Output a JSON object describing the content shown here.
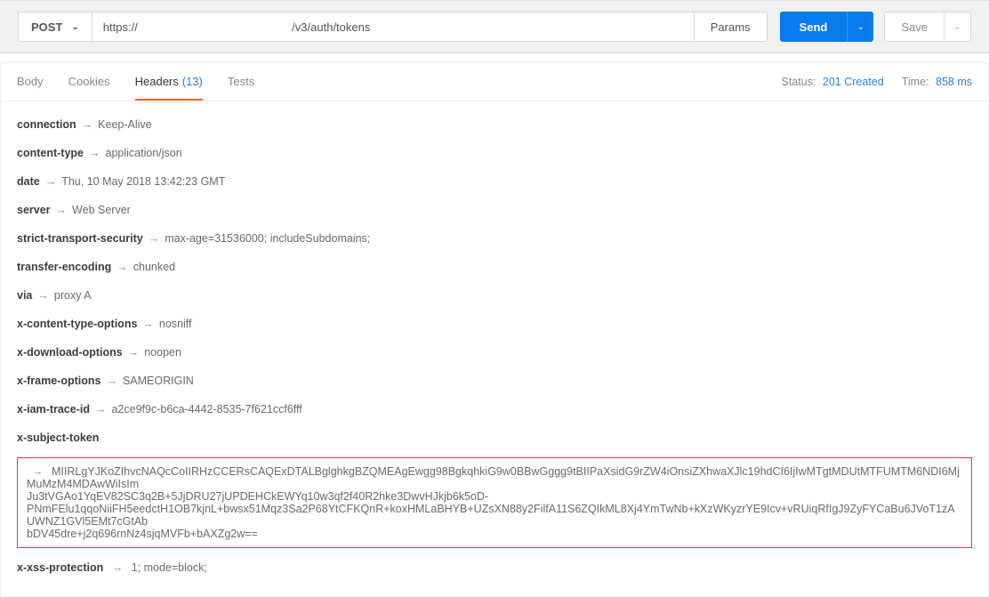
{
  "toolbar": {
    "method": "POST",
    "url_prefix": "https://",
    "url_blur": "                                                ",
    "url_suffix": "/v3/auth/tokens",
    "params": "Params",
    "send": "Send",
    "save": "Save"
  },
  "tabs": {
    "body": "Body",
    "cookies": "Cookies",
    "headers": "Headers",
    "headers_count": "(13)",
    "tests": "Tests"
  },
  "meta": {
    "status_label": "Status:",
    "status_value": "201 Created",
    "time_label": "Time:",
    "time_value": "858 ms"
  },
  "headers": [
    {
      "key": "connection",
      "value": "Keep-Alive"
    },
    {
      "key": "content-type",
      "value": "application/json"
    },
    {
      "key": "date",
      "value": "Thu, 10 May 2018 13:42:23 GMT"
    },
    {
      "key": "server",
      "value": "Web Server"
    },
    {
      "key": "strict-transport-security",
      "value": "max-age=31536000; includeSubdomains;"
    },
    {
      "key": "transfer-encoding",
      "value": "chunked"
    },
    {
      "key": "via",
      "value": "proxy A"
    },
    {
      "key": "x-content-type-options",
      "value": "nosniff"
    },
    {
      "key": "x-download-options",
      "value": "noopen"
    },
    {
      "key": "x-frame-options",
      "value": "SAMEORIGIN"
    },
    {
      "key": "x-iam-trace-id",
      "value": "a2ce9f9c-b6ca-4442-8535-7f621ccf6fff"
    }
  ],
  "token": {
    "key": "x-subject-token",
    "value": "MIIRLgYJKoZIhvcNAQcCoIIRHzCCERsCAQExDTALBglghkgBZQMEAgEwgg98BgkqhkiG9w0BBwGggg9tBIIPaXsidG9rZW4iOnsiZXhwaXJlc19hdCI6IjIwMTgtMDUtMTFUMTM6NDI6MjMuMzM4MDAwWiIsIm\nJu3tVGAo1YqEV82SC3q2B+5JjDRU27jUPDEHCkEWYq10w3qf2f40R2hke3DwvHJkjb6k5oD-\nPNmFElu1qqoNiiFH5eedctH1OB7kjnL+bwsx51Mqz3Sa2P68YtCFKQnR+koxHMLaBHYB+UZsXN88y2FilfA11S6ZQIkML8Xj4YmTwNb+kXzWKyzrYE9Icv+vRUiqRfIgJ9ZyFYCaBu6JVoT1zAUWNZ1GVl5EMt7cGtAb\nbDV45dre+j2q696rnNz4sjqMVFb+bAXZg2w=="
  },
  "xss": {
    "key": "x-xss-protection",
    "value": "1; mode=block;"
  }
}
